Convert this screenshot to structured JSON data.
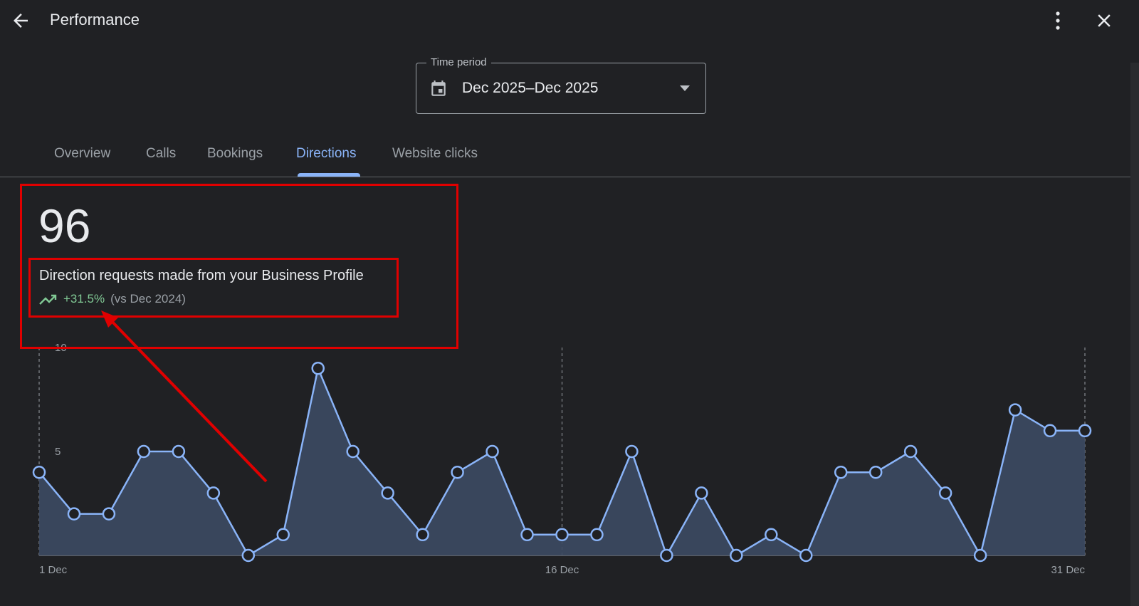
{
  "header": {
    "title": "Performance",
    "back_icon": "arrow-back-icon",
    "menu_icon": "more-vert-icon",
    "close_icon": "close-icon"
  },
  "time_period": {
    "label": "Time period",
    "value": "Dec 2025–Dec 2025",
    "icon": "calendar-icon"
  },
  "tabs": [
    {
      "label": "Overview",
      "active": false
    },
    {
      "label": "Calls",
      "active": false
    },
    {
      "label": "Bookings",
      "active": false
    },
    {
      "label": "Directions",
      "active": true
    },
    {
      "label": "Website clicks",
      "active": false
    }
  ],
  "metric": {
    "value": "96",
    "description": "Direction requests made from your Business Profile",
    "change": "+31.5%",
    "comparison": "(vs Dec 2024)",
    "trend_icon": "trending-up-icon"
  },
  "colors": {
    "background": "#202124",
    "accent": "#8ab4f8",
    "positive": "#81c995",
    "annotation": "#e00000"
  },
  "chart_data": {
    "type": "area",
    "x": [
      1,
      2,
      3,
      4,
      5,
      6,
      7,
      8,
      9,
      10,
      11,
      12,
      13,
      14,
      15,
      16,
      17,
      18,
      19,
      20,
      21,
      22,
      23,
      24,
      25,
      26,
      27,
      28,
      29,
      30,
      31
    ],
    "values": [
      4,
      2,
      2,
      5,
      5,
      3,
      0,
      1,
      9,
      5,
      3,
      1,
      4,
      5,
      1,
      1,
      1,
      5,
      0,
      3,
      0,
      1,
      0,
      4,
      4,
      5,
      3,
      0,
      7,
      6,
      6
    ],
    "y_ticks": [
      "5",
      "10"
    ],
    "x_tick_labels": [
      "1 Dec",
      "16 Dec",
      "31 Dec"
    ],
    "x_tick_days": [
      1,
      16,
      31
    ],
    "ylim": [
      0,
      10
    ],
    "grid": "dashed vertical lines at x ticks"
  }
}
